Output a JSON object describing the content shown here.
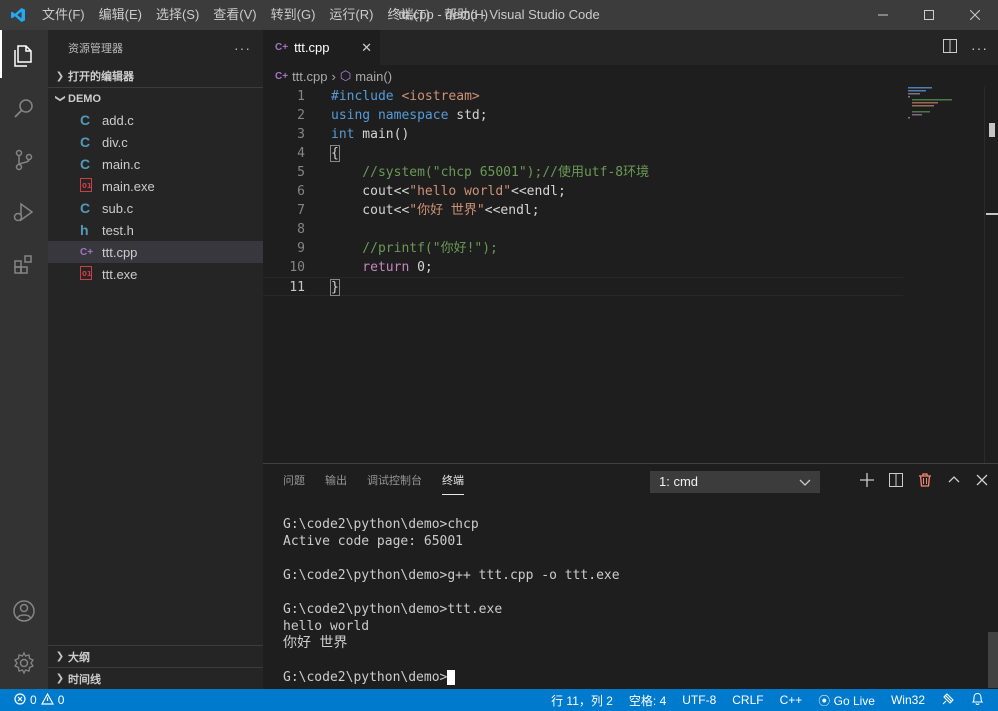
{
  "window": {
    "title": "ttt.cpp - demo - Visual Studio Code",
    "menu": [
      "文件(F)",
      "编辑(E)",
      "选择(S)",
      "查看(V)",
      "转到(G)",
      "运行(R)",
      "终端(T)",
      "帮助(H)"
    ]
  },
  "sidebar": {
    "title": "资源管理器",
    "open_editors": "打开的编辑器",
    "folder": "DEMO",
    "files": [
      {
        "name": "add.c",
        "icon": "C",
        "color": "#519aba"
      },
      {
        "name": "div.c",
        "icon": "C",
        "color": "#519aba"
      },
      {
        "name": "main.c",
        "icon": "C",
        "color": "#519aba"
      },
      {
        "name": "main.exe",
        "icon": "exe",
        "color": "#cc3e44"
      },
      {
        "name": "sub.c",
        "icon": "C",
        "color": "#519aba"
      },
      {
        "name": "test.h",
        "icon": "h",
        "color": "#519aba"
      },
      {
        "name": "ttt.cpp",
        "icon": "C++",
        "color": "#a074c4"
      },
      {
        "name": "ttt.exe",
        "icon": "exe",
        "color": "#cc3e44"
      }
    ],
    "outline": "大纲",
    "timeline": "时间线"
  },
  "editor": {
    "tab": "ttt.cpp",
    "breadcrumb": {
      "file": "ttt.cpp",
      "symbol": "main()"
    },
    "line_numbers": [
      "1",
      "2",
      "3",
      "4",
      "5",
      "6",
      "7",
      "8",
      "9",
      "10",
      "11"
    ],
    "code": {
      "l1a": "#include ",
      "l1b": "<iostream>",
      "l2a": "using",
      "l2b": " namespace",
      "l2c": " std;",
      "l3a": "int",
      "l3b": " main()",
      "l4": "{",
      "l6": "    //system(\"chcp 65001\");//使用utf-8环境",
      "l7a": "    cout<<",
      "l7b": "\"hello world\"",
      "l7c": "<<endl;",
      "l8a": "    cout<<",
      "l8b": "\"你好 世界\"",
      "l8c": "<<endl;",
      "l10": "    //printf(\"你好!\");",
      "l11a": "    return",
      "l11b": " 0;",
      "l12": "}"
    }
  },
  "panel": {
    "tabs": [
      "问题",
      "输出",
      "调试控制台",
      "终端"
    ],
    "active_tab": "终端",
    "terminal_select": "1: cmd",
    "terminal_lines": [
      "G:\\code2\\python\\demo>chcp",
      "Active code page: 65001",
      "",
      "G:\\code2\\python\\demo>g++ ttt.cpp -o ttt.exe",
      "",
      "G:\\code2\\python\\demo>ttt.exe",
      "hello world",
      "你好 世界",
      ""
    ],
    "prompt": "G:\\code2\\python\\demo>"
  },
  "status": {
    "errors": "0",
    "warnings": "0",
    "position": "行 11，列 2",
    "spaces": "空格: 4",
    "encoding": "UTF-8",
    "eol": "CRLF",
    "language": "C++",
    "live": "Go Live",
    "platform": "Win32"
  }
}
